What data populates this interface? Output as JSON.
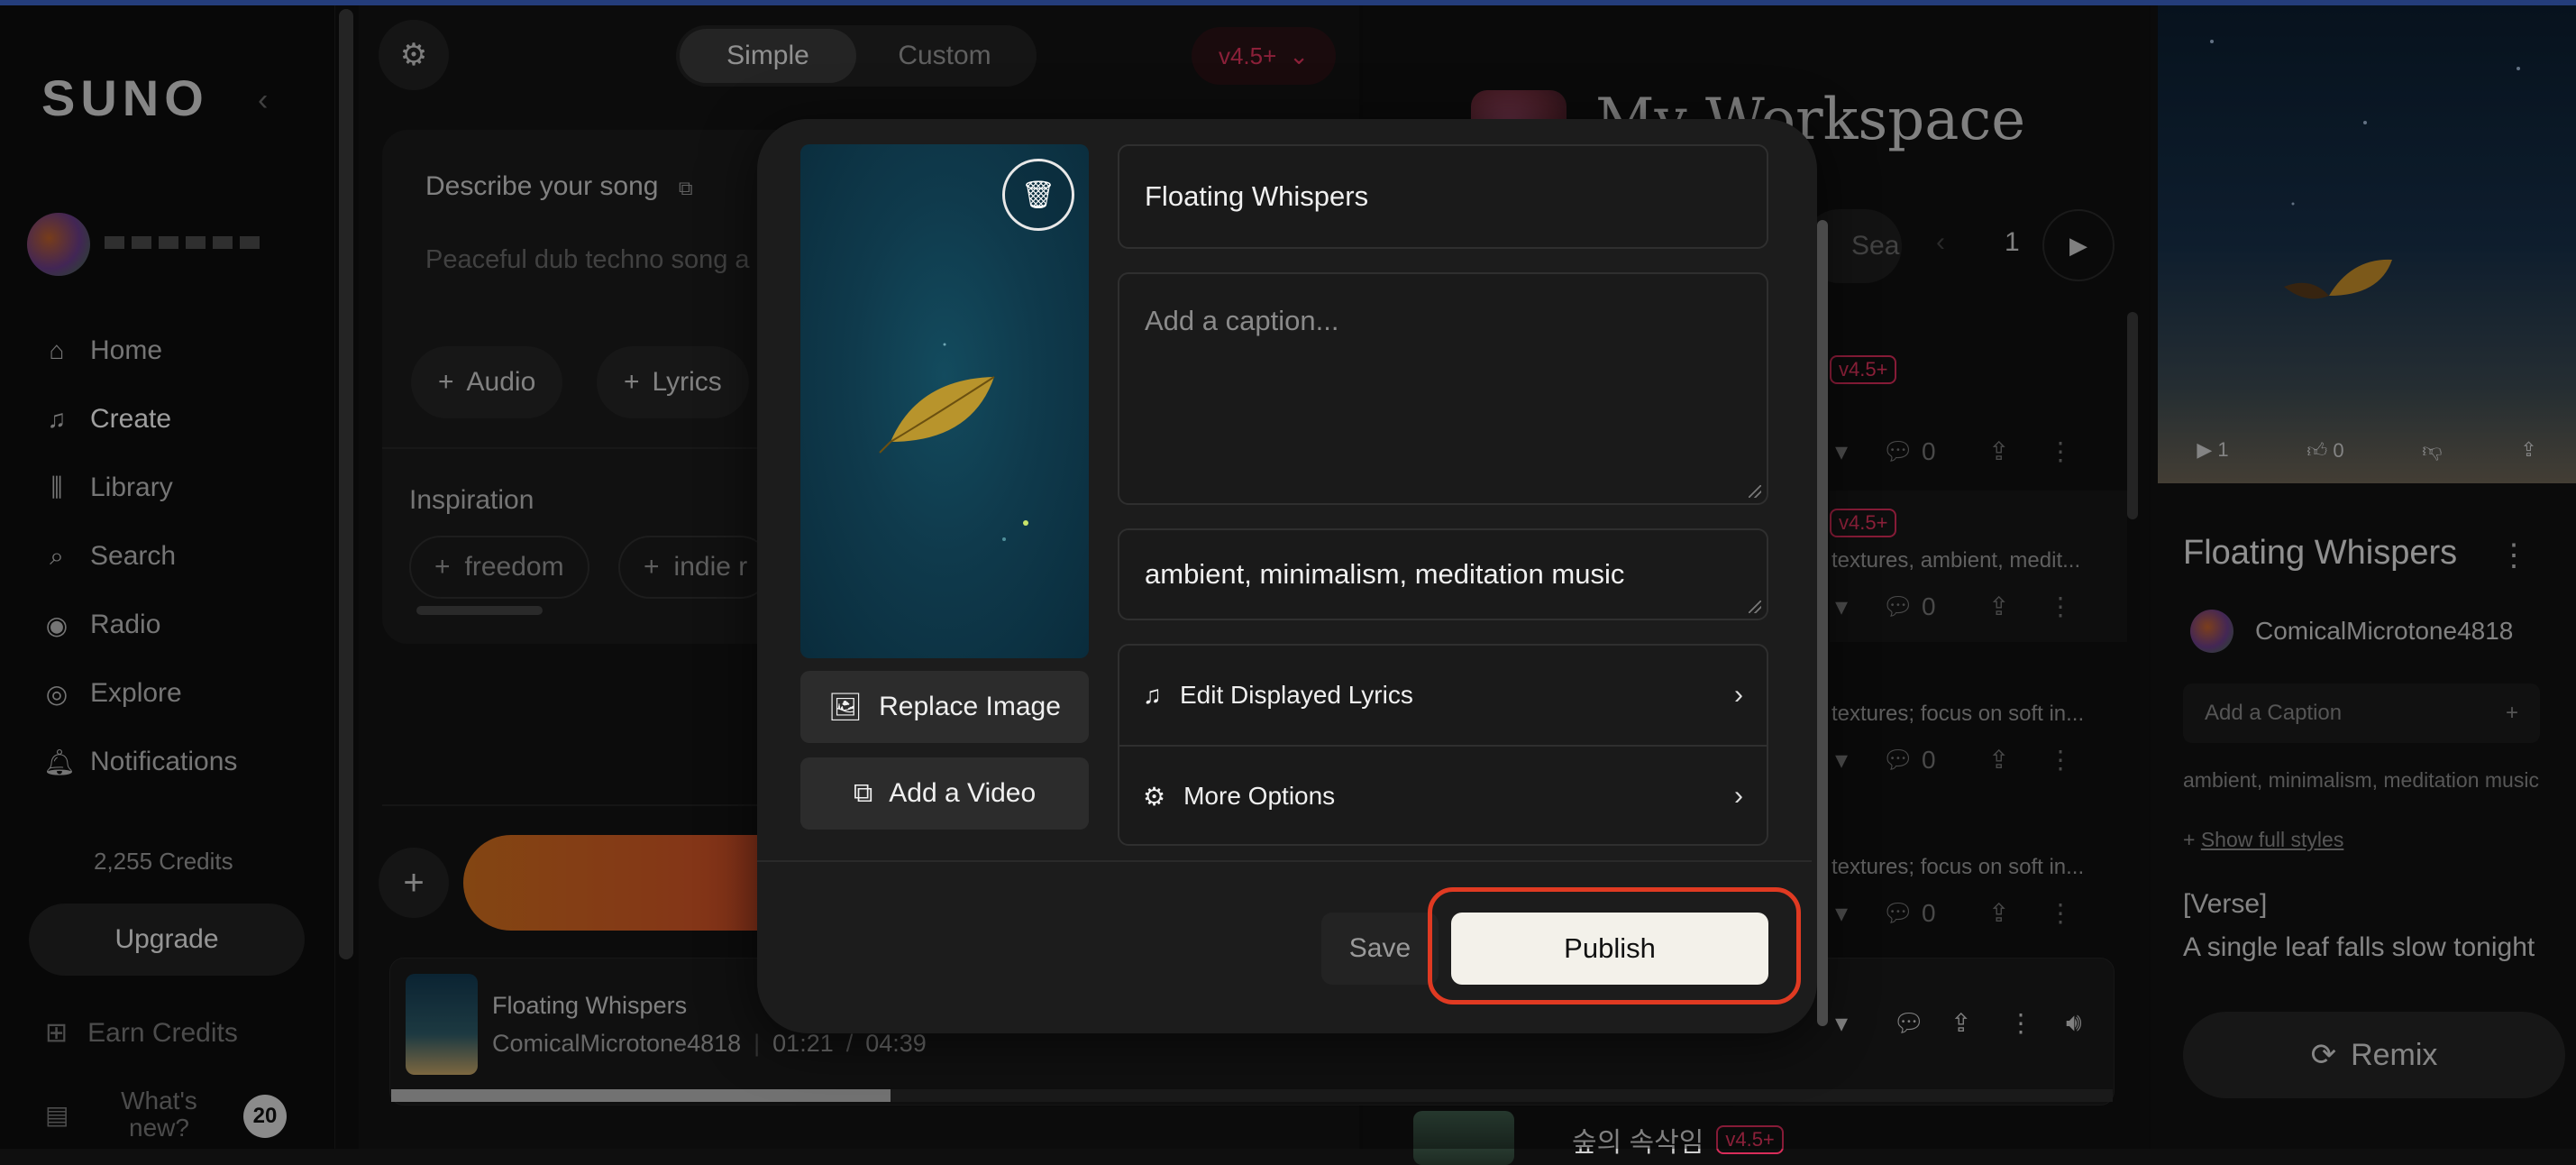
{
  "sidebar": {
    "logo": "SUNO",
    "collapse_icon": "chevron-left-icon",
    "nav": [
      {
        "label": "Home",
        "icon": "home-icon"
      },
      {
        "label": "Create",
        "icon": "music-note-icon"
      },
      {
        "label": "Library",
        "icon": "library-icon"
      },
      {
        "label": "Search",
        "icon": "search-icon"
      },
      {
        "label": "Radio",
        "icon": "radio-icon"
      },
      {
        "label": "Explore",
        "icon": "compass-icon"
      },
      {
        "label": "Notifications",
        "icon": "bell-icon"
      }
    ],
    "credits": "2,255 Credits",
    "upgrade_label": "Upgrade",
    "earn_label": "Earn Credits",
    "whats_new_label": "What's new?",
    "whats_new_count": "20"
  },
  "create": {
    "mode_tabs": [
      "Simple",
      "Custom"
    ],
    "active_mode": "Simple",
    "version": "v4.5+",
    "describe_title": "Describe your song",
    "describe_placeholder": "Peaceful dub techno song a",
    "audio_label": "Audio",
    "lyrics_label": "Lyrics",
    "inspiration_title": "Inspiration",
    "inspiration_chips": [
      "freedom",
      "indie r"
    ]
  },
  "player": {
    "title": "Floating Whispers",
    "artist": "ComicalMicrotone4818",
    "current_time": "01:21",
    "separator": "/",
    "duration": "04:39",
    "progress": 0.29
  },
  "workspace": {
    "title": "My Workspace",
    "search_placeholder": "Sea",
    "page": "1",
    "version_tag": "v4.5+",
    "rows": [
      {
        "style": "",
        "comments": "0"
      },
      {
        "style": "textures, ambient, medit...",
        "comments": "0"
      },
      {
        "style": "textures; focus on soft in...",
        "comments": "0"
      },
      {
        "style": "textures; focus on soft in...",
        "comments": "0"
      }
    ],
    "next_song_title": "숲의 속삭임",
    "next_song_version": "v4.5+"
  },
  "right_panel": {
    "plays": "1",
    "likes": "0",
    "title": "Floating Whispers",
    "author": "ComicalMicrotone4818",
    "caption_placeholder": "Add a Caption",
    "styles": "ambient, minimalism, meditation music",
    "show_styles": "Show full styles",
    "verse_tag": "[Verse]",
    "lyric_line": "A single leaf falls slow tonight",
    "remix_label": "Remix"
  },
  "modal": {
    "title_value": "Floating Whispers",
    "caption_placeholder": "Add a caption...",
    "styles_value": "ambient, minimalism, meditation music",
    "replace_image_label": "Replace Image",
    "add_video_label": "Add a Video",
    "edit_lyrics_label": "Edit Displayed Lyrics",
    "more_options_label": "More Options",
    "save_label": "Save",
    "publish_label": "Publish",
    "highlight_color": "#e03a22"
  }
}
